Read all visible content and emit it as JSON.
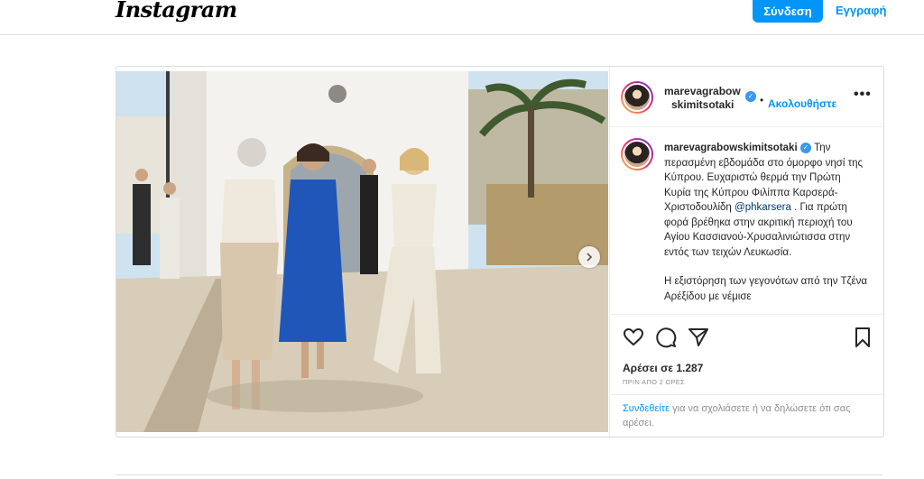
{
  "header": {
    "logo_text": "Instagram",
    "login_label": "Σύνδεση",
    "signup_label": "Εγγραφή"
  },
  "post": {
    "author_line1": "marevagrabow",
    "author_line2": "skimitsotaki",
    "dot": "•",
    "follow_label": "Ακολουθήστε",
    "more_label": "•••",
    "caption_username": "marevagrabowskimitsotaki",
    "caption_part1": "Την περασμένη εβδομάδα στο όμορφο νησί της Κύπρου. Ευχαριστώ θερμά την Πρώτη Κυρία της Κύπρου Φιλίππα Καρσερά-Χριστοδουλίδη",
    "caption_mention": "@phkarsera",
    "caption_part2": ". Για πρώτη φορά βρέθηκα στην ακριτική περιοχή του Αγίου Κασσιανού-Χρυσαλινιώτισσα στην εντός των τειχών Λευκωσία.",
    "caption_para2": "Η εξιστόρηση των γεγονότων από την Τζένα Αρέξίδου με νέμισε",
    "likes_text": "Αρέσει σε 1.287",
    "time_text": "ΠΡΙΝ ΑΠΟ 2 ΩΡΕΣ",
    "comment_link": "Συνδεθείτε",
    "comment_rest": " για να σχολιάσετε ή να δηλώσετε ότι σας αρέσει."
  },
  "icons": {
    "verified": "verified-badge",
    "like": "heart-icon",
    "comment": "comment-icon",
    "share": "send-icon",
    "save": "bookmark-icon",
    "next": "chevron-right-icon"
  },
  "colors": {
    "accent": "#0095f6",
    "verified": "#3897f0",
    "border": "#dbdbdb"
  }
}
